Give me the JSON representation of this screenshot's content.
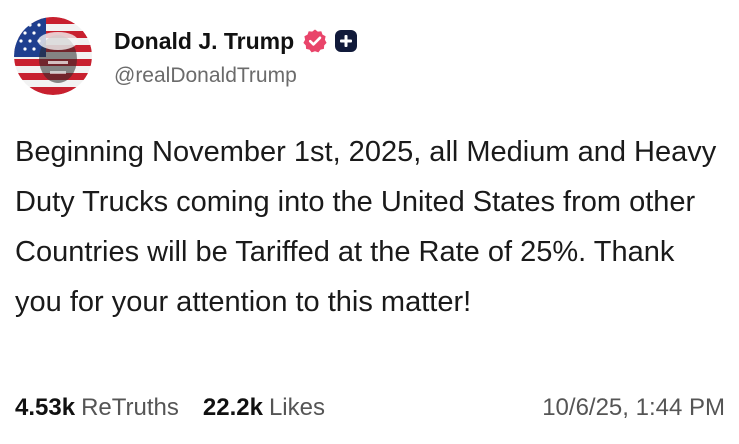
{
  "author": {
    "display_name": "Donald J. Trump",
    "handle": "@realDonaldTrump",
    "verified_icon": "verified-check-icon",
    "plus_icon": "plus-badge-icon",
    "verified_color": "#e9446a"
  },
  "post": {
    "text": "Beginning November 1st, 2025, all Medium and Heavy Duty Trucks coming into the United States from other Countries will be Tariffed at the Rate of 25%. Thank you for your attention to this matter!"
  },
  "stats": {
    "retruths_count": "4.53k",
    "retruths_label": "ReTruths",
    "likes_count": "22.2k",
    "likes_label": "Likes"
  },
  "timestamp": "10/6/25, 1:44 PM"
}
